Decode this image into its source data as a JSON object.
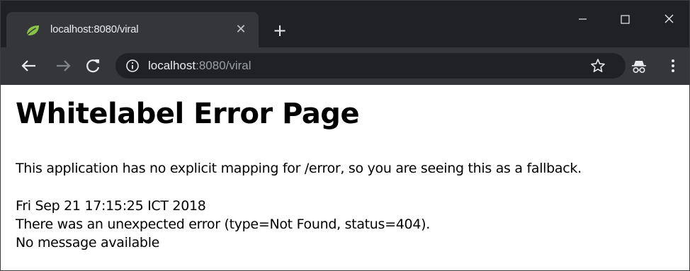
{
  "browser": {
    "tab": {
      "title": "localhost:8080/viral",
      "close_glyph": "✕",
      "favicon": "spring-leaf-icon"
    },
    "new_tab_glyph": "+",
    "window_controls": {
      "minimize": "minimize-icon",
      "maximize": "maximize-icon",
      "close": "close-icon"
    },
    "toolbar": {
      "back": "arrow-left-icon",
      "forward": "arrow-right-icon",
      "reload": "reload-icon",
      "url_host": "localhost",
      "url_rest": ":8080/viral",
      "site_info": "info-icon",
      "bookmark": "star-icon",
      "profile": "incognito-icon",
      "menu": "kebab-menu-icon"
    },
    "colors": {
      "tabstrip": "#202124",
      "toolbar": "#35363a",
      "omnibox": "#202124",
      "favicon_green": "#8bc34a"
    }
  },
  "page": {
    "title": "Whitelabel Error Page",
    "fallback_text": "This application has no explicit mapping for /error, so you are seeing this as a fallback.",
    "timestamp": "Fri Sep 21 17:15:25 ICT 2018",
    "error_text": "There was an unexpected error (type=Not Found, status=404).",
    "message": "No message available"
  }
}
